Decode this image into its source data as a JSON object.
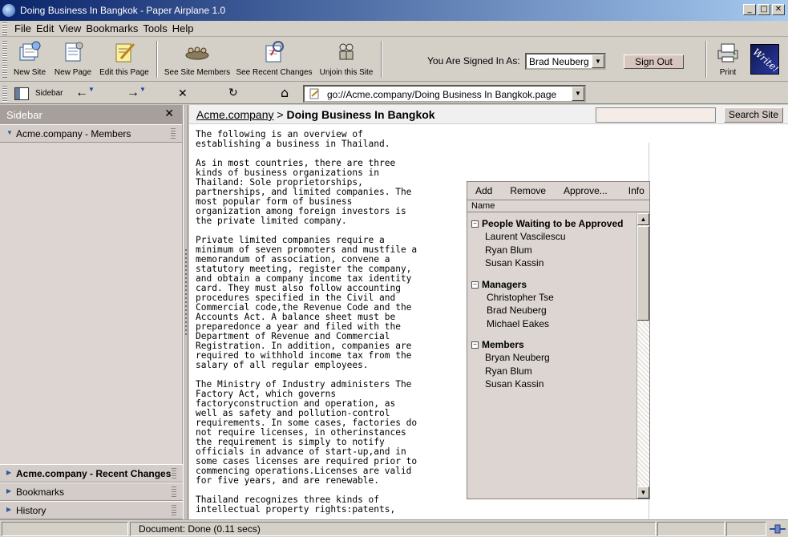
{
  "window": {
    "title": "Doing Business In Bangkok - Paper Airplane 1.0",
    "min_glyph": "_",
    "max_glyph": "□",
    "close_glyph": "✕"
  },
  "menu": [
    "File",
    "Edit",
    "View",
    "Bookmarks",
    "Tools",
    "Help"
  ],
  "toolbar": {
    "new_site": "New Site",
    "new_page": "New Page",
    "edit_page": "Edit this Page",
    "site_members": "See Site Members",
    "recent_changes": "See Recent Changes",
    "unjoin": "Unjoin this Site",
    "signed_in_label": "You Are Signed In As:",
    "signed_in_user": "Brad Neuberg",
    "sign_out": "Sign Out",
    "print": "Print",
    "write": "Write!"
  },
  "nav": {
    "sidebar_label": "Sidebar",
    "back_glyph": "←",
    "forward_glyph": "→",
    "stop_glyph": "✕",
    "reload_glyph": "↻",
    "home_glyph": "⌂",
    "url": "go://Acme.company/Doing Business In Bangkok.page"
  },
  "sidebar": {
    "title": "Sidebar",
    "close_glyph": "✕",
    "top_panel": "Acme.company - Members",
    "bottom_panels": [
      "Acme.company - Recent Changes",
      "Bookmarks",
      "History"
    ]
  },
  "content": {
    "breadcrumb_site": "Acme.company",
    "breadcrumb_sep": " > ",
    "breadcrumb_page": "Doing Business In Bangkok",
    "search_button": "Search Site",
    "paragraphs": [
      "The following is an overview of\nestablishing a business in Thailand.",
      "As in most countries, there are three\nkinds of business organizations in\nThailand: Sole proprietorships,\npartnerships, and limited companies. The\nmost popular form of business\norganization among foreign investors is\nthe private limited company.",
      "Private limited companies require a\nminimum of seven promoters and mustfile a\nmemorandum of association, convene a\nstatutory meeting, register the company,\nand obtain a company income tax identity\ncard. They must also follow accounting\nprocedures specified in the Civil and\nCommercial code,the Revenue Code and the\nAccounts Act. A balance sheet must be\npreparedonce a year and filed with the\nDepartment of Revenue and Commercial\nRegistration. In addition, companies are\nrequired to withhold income tax from the\nsalary of all regular employees.",
      "The Ministry of Industry administers The\nFactory Act, which governs\nfactoryconstruction and operation, as\nwell as safety and pollution-control\nrequirements. In some cases, factories do\nnot require licenses, in otherinstances\nthe requirement is simply to notify\nofficials in advance of start-up,and in\nsome cases licenses are required prior to\ncommencing operations.Licenses are valid\nfor five years, and are renewable.",
      "Thailand recognizes three kinds of\nintellectual property rights:patents,"
    ]
  },
  "members_panel": {
    "menu": [
      "Add",
      "Remove",
      "Approve...",
      "Info"
    ],
    "column": "Name",
    "groups": [
      {
        "name": "People Waiting to be Approved",
        "members": [
          "Laurent Vascilescu",
          "Ryan Blum",
          "Susan Kassin"
        ]
      },
      {
        "name": "Managers",
        "members": [
          "Christopher Tse",
          "Brad Neuberg",
          "Michael Eakes"
        ]
      },
      {
        "name": "Members",
        "members": [
          "Bryan Neuberg",
          "Ryan Blum",
          "Susan Kassin"
        ]
      }
    ],
    "expanded_glyph": "−"
  },
  "status": {
    "text": "Document: Done (0.11 secs)"
  }
}
